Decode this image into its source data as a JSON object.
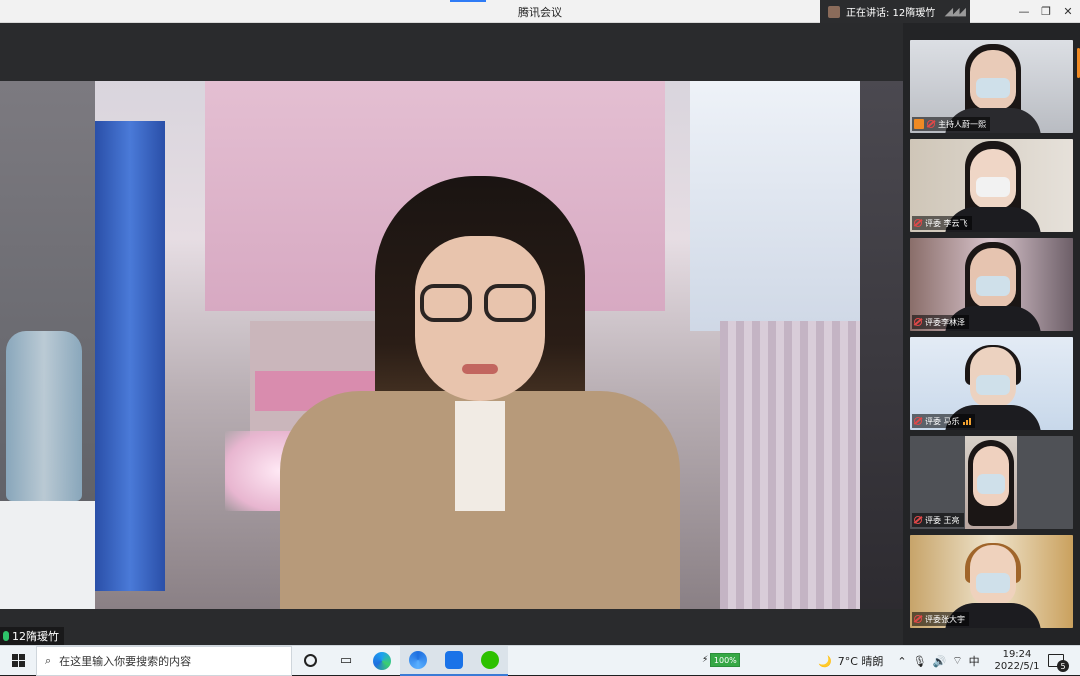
{
  "window": {
    "title": "腾讯会议",
    "speaking_label": "正在讲话: 12隋瑷竹",
    "controls": [
      "minimize",
      "restore",
      "close"
    ]
  },
  "main_video": {
    "participant_name": "12隋瑷竹",
    "mic_state": "on"
  },
  "participants": [
    {
      "label": "主持人蔚一熙",
      "role": "host",
      "mic": "muted"
    },
    {
      "label": "评委 李云飞",
      "role": "judge",
      "mic": "muted"
    },
    {
      "label": "评委李林泽",
      "role": "judge",
      "mic": "muted"
    },
    {
      "label": "评委 马乐",
      "role": "judge",
      "mic": "active"
    },
    {
      "label": "评委 王亮",
      "role": "judge",
      "mic": "muted"
    },
    {
      "label": "评委张大宇",
      "role": "judge",
      "mic": "muted"
    }
  ],
  "taskbar": {
    "search_placeholder": "在这里输入你要搜索的内容",
    "battery": "100%",
    "weather": "7°C 晴朗",
    "ime": "中",
    "time": "19:24",
    "date": "2022/5/1",
    "notifications": "5"
  },
  "colors": {
    "accent": "#2f7cf6",
    "host_badge": "#f08a24",
    "mic_on": "#2ec36a",
    "mic_muted": "#e04848"
  }
}
